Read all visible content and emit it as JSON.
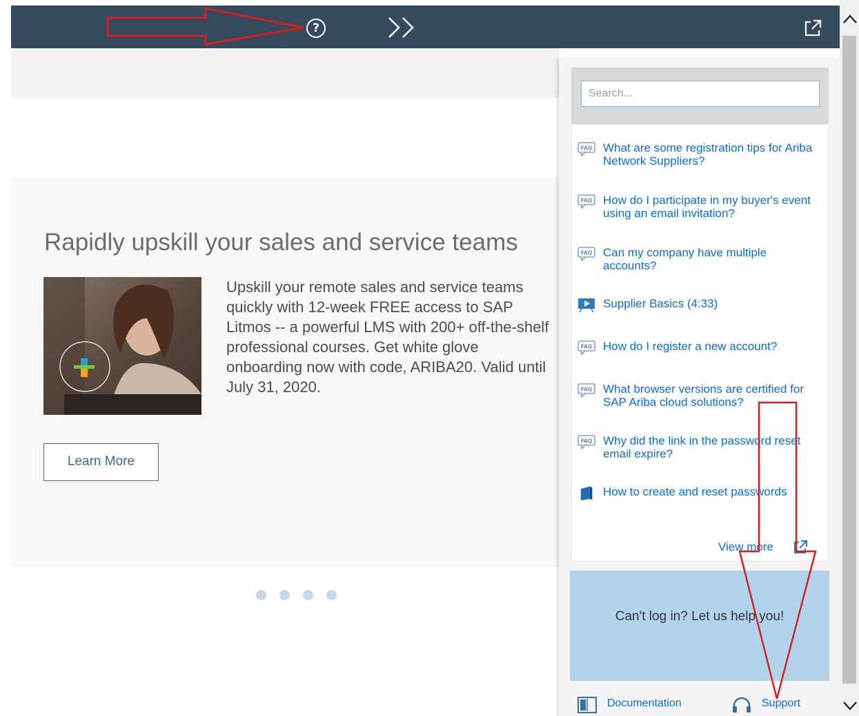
{
  "header": {
    "help_icon": "help-circle-icon",
    "help_glyph": "?",
    "collapse_icon": "double-chevron-right-icon",
    "popout_icon": "popout-icon",
    "bar_color": "#354a5f"
  },
  "promo": {
    "title": "Rapidly upskill your sales and service teams",
    "body": "Upskill your remote sales and service teams\nquickly with 12-week FREE access to SAP\nLitmos -- a powerful LMS with 200+ off-the-shelf\nprofessional courses. Get white glove\nonboarding now with code, ARIBA20. Valid until\nJuly 31, 2020.",
    "button_label": "Learn More",
    "carousel_dots": 4
  },
  "help_panel": {
    "search_placeholder": "Search...",
    "items": [
      {
        "icon": "faq-icon",
        "label": "What are some registration tips for Ariba Network Suppliers?"
      },
      {
        "icon": "faq-icon",
        "label": "How do I participate in my buyer's event using an email invitation?"
      },
      {
        "icon": "faq-icon",
        "label": "Can my company have multiple accounts?"
      },
      {
        "icon": "video-icon",
        "label": "Supplier Basics (4:33)"
      },
      {
        "icon": "faq-icon",
        "label": "How do I register a new account?"
      },
      {
        "icon": "faq-icon",
        "label": "What browser versions are certified for SAP Ariba cloud solutions?"
      },
      {
        "icon": "faq-icon",
        "label": "Why did the link in the password reset email expire?"
      },
      {
        "icon": "book-icon",
        "label": "How to create and reset passwords"
      }
    ],
    "view_more": "View more",
    "login_help": "Can't log in? Let us help you!",
    "footer": {
      "documentation": "Documentation",
      "support": "Support"
    }
  },
  "colors": {
    "link": "#0a6ed1",
    "login_box": "#b1d3ec",
    "annotation_arrow": "#d42020"
  }
}
